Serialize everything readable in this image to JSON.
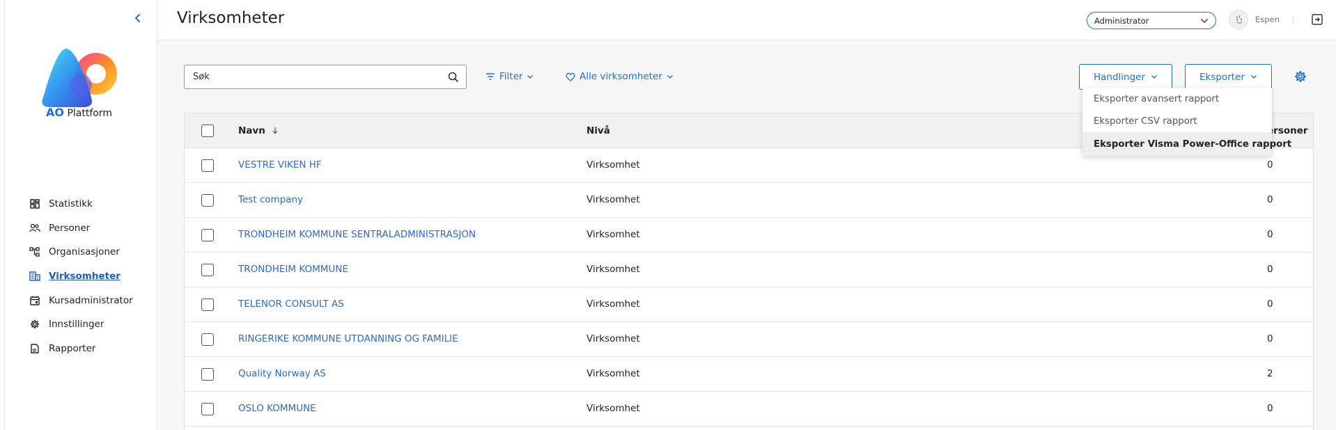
{
  "sidebar": {
    "logo": {
      "brand": "AO",
      "name": "Plattform"
    },
    "items": [
      {
        "label": "Statistikk",
        "icon": "dashboard-icon"
      },
      {
        "label": "Personer",
        "icon": "people-icon"
      },
      {
        "label": "Organisasjoner",
        "icon": "org-chart-icon"
      },
      {
        "label": "Virksomheter",
        "icon": "building-icon",
        "active": true
      },
      {
        "label": "Kursadministrator",
        "icon": "calendar-icon"
      },
      {
        "label": "Innstillinger",
        "icon": "gear-icon"
      },
      {
        "label": "Rapporter",
        "icon": "report-icon"
      }
    ]
  },
  "header": {
    "title": "Virksomheter",
    "role": "Administrator",
    "user": "Espen"
  },
  "toolbar": {
    "search_placeholder": "Søk",
    "filter_label": "Filter",
    "all_label": "Alle virksomheter",
    "actions_label": "Handlinger",
    "export_label": "Eksporter"
  },
  "export_menu": {
    "items": [
      "Eksporter avansert rapport",
      "Eksporter CSV rapport",
      "Eksporter Visma Power-Office rapport"
    ]
  },
  "table": {
    "columns": {
      "name": "Navn",
      "level": "Nivå",
      "persons": "ersoner"
    },
    "rows": [
      {
        "name": "VESTRE VIKEN HF",
        "level": "Virksomhet",
        "count": "0"
      },
      {
        "name": "Test company",
        "level": "Virksomhet",
        "count": "0"
      },
      {
        "name": "TRONDHEIM KOMMUNE SENTRALADMINISTRASJON",
        "level": "Virksomhet",
        "count": "0"
      },
      {
        "name": "TRONDHEIM KOMMUNE",
        "level": "Virksomhet",
        "count": "0"
      },
      {
        "name": "TELENOR CONSULT AS",
        "level": "Virksomhet",
        "count": "0"
      },
      {
        "name": "RINGERIKE KOMMUNE UTDANNING OG FAMILIE",
        "level": "Virksomhet",
        "count": "0"
      },
      {
        "name": "Quality Norway AS",
        "level": "Virksomhet",
        "count": "2"
      },
      {
        "name": "OSLO KOMMUNE",
        "level": "Virksomhet",
        "count": "0"
      }
    ]
  },
  "colors": {
    "accent": "#1f6fd6",
    "link": "#2b6ad0"
  }
}
